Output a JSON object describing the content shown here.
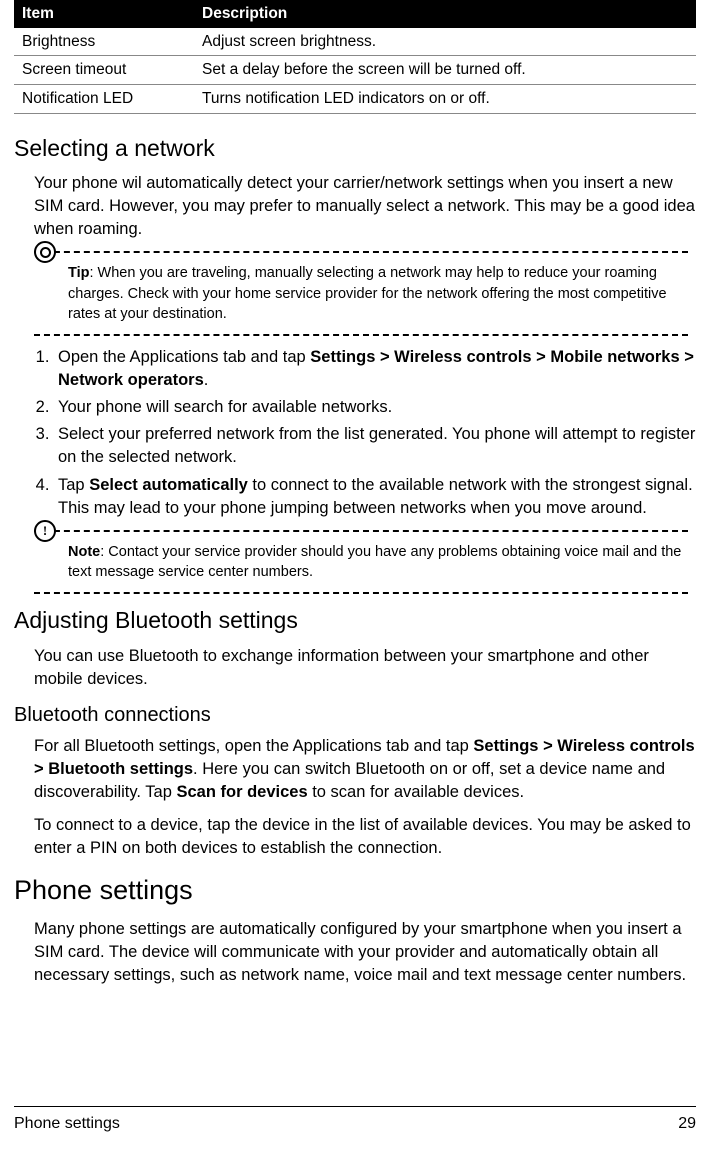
{
  "table": {
    "headers": [
      "Item",
      "Description"
    ],
    "rows": [
      {
        "item": "Brightness",
        "desc": "Adjust screen brightness."
      },
      {
        "item": "Screen timeout",
        "desc": "Set a delay before the screen will be turned off."
      },
      {
        "item": "Notification LED",
        "desc": "Turns notification LED indicators on or off."
      }
    ]
  },
  "section1": {
    "heading": "Selecting a network",
    "intro": "Your phone wil automatically detect your carrier/network settings when you insert a new SIM card. However, you may prefer to manually select a network. This may be a good idea when roaming.",
    "tip_label": "Tip",
    "tip_text": ": When you are traveling, manually selecting a network may help to reduce your roaming charges. Check with your home service provider for the network offering the most competitive rates at your destination.",
    "steps": {
      "s1a": "Open the Applications tab and tap ",
      "s1b": "Settings > Wireless controls > Mobile networks > Network operators",
      "s1c": ".",
      "s2": "Your phone will search for available networks.",
      "s3": "Select your preferred network from the list generated. You phone will attempt to register on the selected network.",
      "s4a": "Tap ",
      "s4b": "Select automatically",
      "s4c": " to connect to the available network with the strongest signal. This may lead to your phone jumping between networks when you move around."
    },
    "note_label": "Note",
    "note_text": ": Contact your service provider should you have any problems obtaining voice mail and the text message service center numbers."
  },
  "section2": {
    "heading": "Adjusting Bluetooth settings",
    "intro": "You can use Bluetooth to exchange information between your smartphone and other mobile devices.",
    "sub_heading": "Bluetooth connections",
    "p1a": "For all Bluetooth settings, open the Applications tab and tap ",
    "p1b": "Settings > Wireless controls > Bluetooth settings",
    "p1c": ". Here you can switch Bluetooth on or off, set a device name and discoverability. Tap ",
    "p1d": "Scan for devices",
    "p1e": " to scan for available devices.",
    "p2": "To connect to a device, tap the device in the list of available devices. You may be asked to enter a PIN on both devices to establish the connection."
  },
  "section3": {
    "heading": "Phone settings",
    "intro": "Many phone settings are automatically configured by your smartphone when you insert a SIM card. The device will communicate with your provider and automatically obtain all necessary settings, such as network name, voice mail and text message center numbers."
  },
  "footer": {
    "left": "Phone settings",
    "right": "29"
  }
}
